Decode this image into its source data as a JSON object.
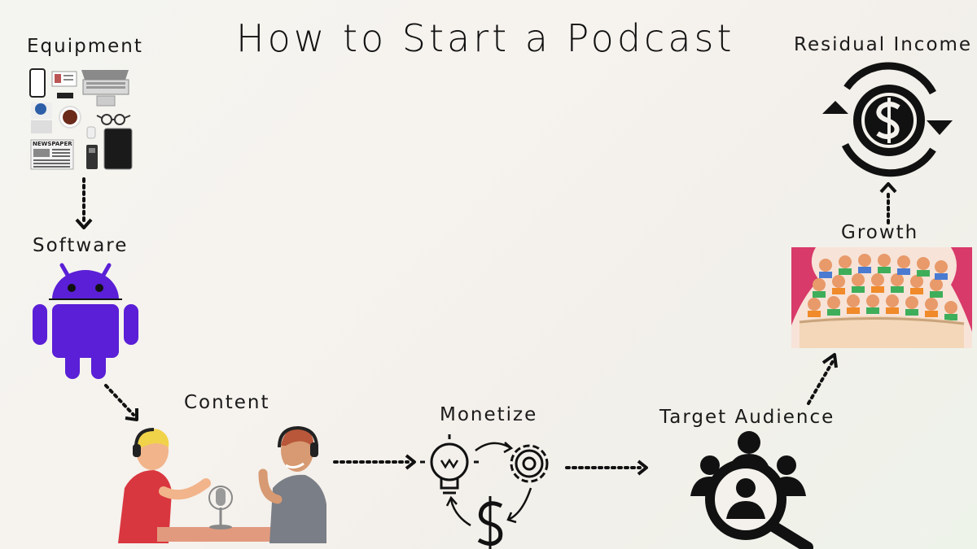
{
  "title": "How to Start a Podcast",
  "steps": {
    "equipment": "Equipment",
    "software": "Software",
    "content": "Content",
    "monetize": "Monetize",
    "target_audience": "Target Audience",
    "growth": "Growth",
    "residual_income": "Residual Income"
  },
  "equipment_items": {
    "newspaper": "NEWSPAPER"
  },
  "colors": {
    "android": "#5a1fd6",
    "host_left_shirt": "#d9373f",
    "host_right_shirt": "#7a7e86",
    "desk": "#e29a7f",
    "curtain": "#d83a6a",
    "stage": "#f3d7b8",
    "icon_dark": "#111111"
  }
}
